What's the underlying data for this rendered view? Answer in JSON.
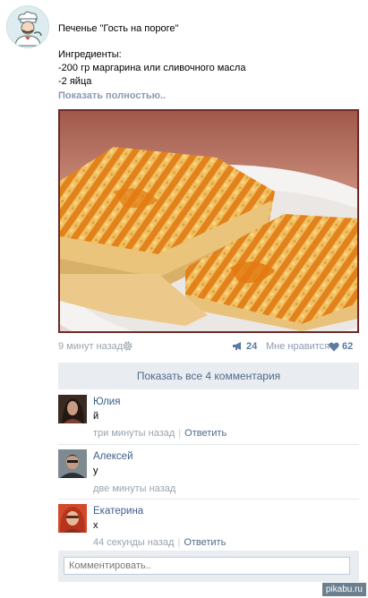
{
  "post": {
    "title": "Печенье \"Гость на пороге\"",
    "lines": [
      "Ингредиенты:",
      "-200 гр маргарина или сливочного масла",
      "-2 яйца"
    ],
    "show_more": "Показать полностью..",
    "photo_alt": "",
    "time": "9 минут назад",
    "shares": "24",
    "like_label": "Мне нравится",
    "likes": "62"
  },
  "comments_toggle": "Показать все 4 комментария",
  "comments": [
    {
      "name": "Юлия",
      "text": "й",
      "time": "три минуты назад",
      "reply": "Ответить"
    },
    {
      "name": "Алексей",
      "text": "у",
      "time": "две минуты назад"
    },
    {
      "name": "Екатерина",
      "text": "х",
      "time": "44 секунды назад",
      "reply": "Ответить"
    }
  ],
  "comment_input": {
    "placeholder": "Комментировать.."
  },
  "watermark": "pikabu.ru",
  "colors": {
    "link": "#3d5f8a",
    "meta": "#9aa4ae",
    "panel": "#e9edf1",
    "photo_border": "#6b2a27"
  },
  "icons": [
    "chef-icon",
    "gear-icon",
    "megaphone-icon",
    "heart-icon"
  ]
}
